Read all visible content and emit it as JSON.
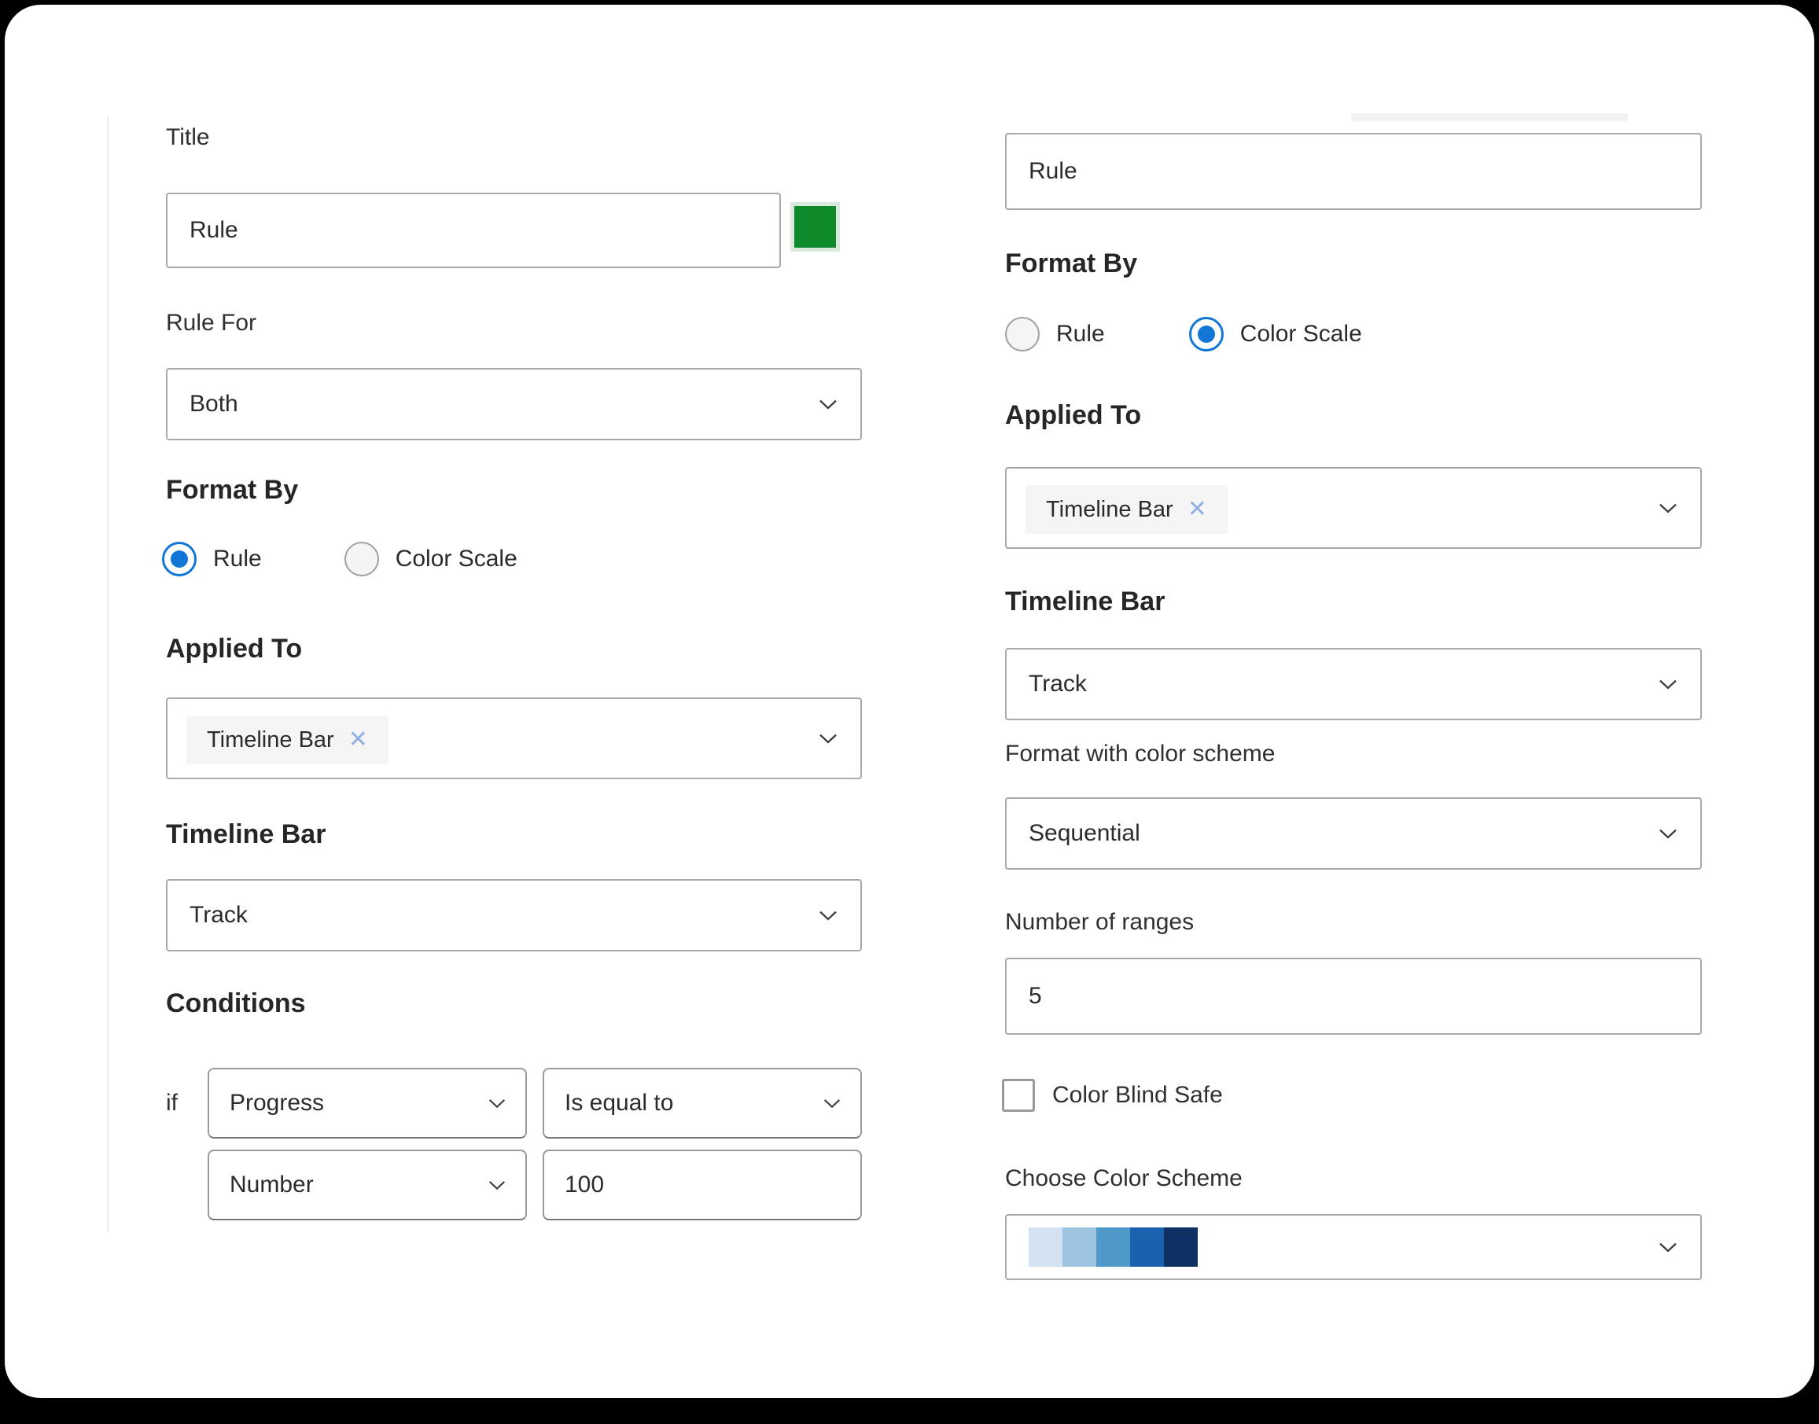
{
  "theme": {
    "accent_blue": "#1176d6",
    "swatch_green": "#0e8a2b",
    "tag_bg": "#f5f5f5",
    "scheme_colors": [
      "#d4e2f1",
      "#9dc5e1",
      "#4e98ca",
      "#1b62ae",
      "#0e3063"
    ]
  },
  "left": {
    "title_label": "Title",
    "title_value": "Rule",
    "rule_for_label": "Rule For",
    "rule_for_value": "Both",
    "format_by_label": "Format By",
    "format_by_options": [
      {
        "label": "Rule",
        "selected": true
      },
      {
        "label": "Color Scale",
        "selected": false
      }
    ],
    "applied_to_label": "Applied To",
    "applied_to_tag": "Timeline Bar",
    "tag_remove_glyph": "✕",
    "timeline_bar_label": "Timeline Bar",
    "timeline_bar_value": "Track",
    "conditions_label": "Conditions",
    "if_label": "if",
    "condition": {
      "field": "Progress",
      "operator": "Is equal to",
      "value_type": "Number",
      "value": "100"
    }
  },
  "right": {
    "title_value": "Rule",
    "format_by_label": "Format By",
    "format_by_options": [
      {
        "label": "Rule",
        "selected": false
      },
      {
        "label": "Color Scale",
        "selected": true
      }
    ],
    "applied_to_label": "Applied To",
    "applied_to_tag": "Timeline Bar",
    "tag_remove_glyph": "✕",
    "timeline_bar_label": "Timeline Bar",
    "timeline_bar_value": "Track",
    "format_with_scheme_label": "Format with color scheme",
    "scheme_type_value": "Sequential",
    "num_ranges_label": "Number of ranges",
    "num_ranges_value": "5",
    "color_blind_label": "Color Blind Safe",
    "color_blind_checked": false,
    "choose_scheme_label": "Choose Color Scheme"
  }
}
